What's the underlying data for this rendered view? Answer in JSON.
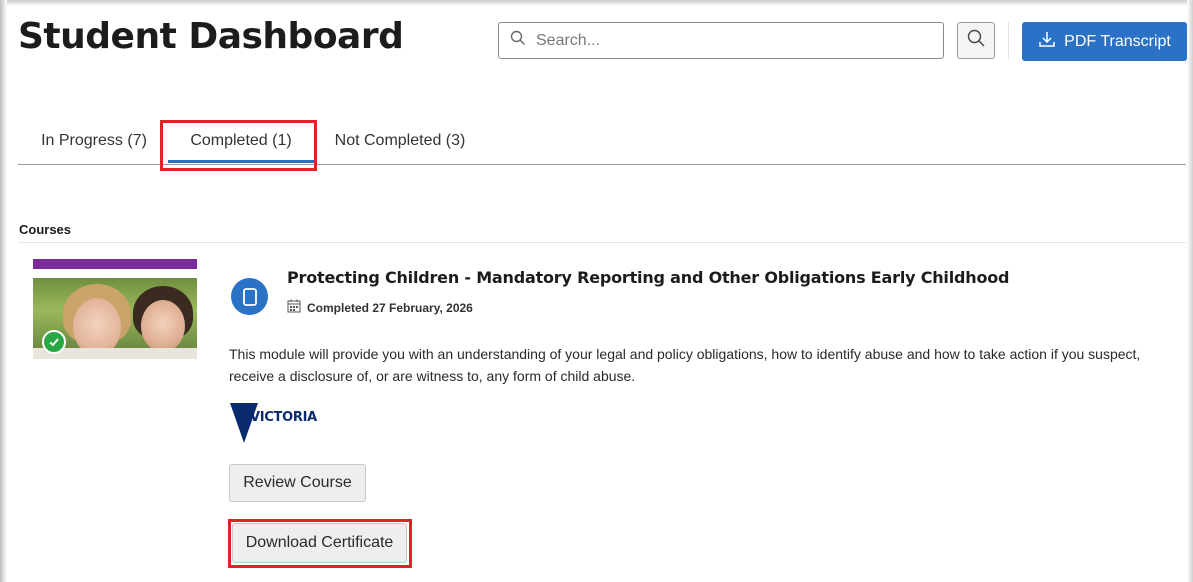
{
  "header": {
    "title": "Student Dashboard",
    "search_placeholder": "Search...",
    "pdf_button_label": "PDF Transcript"
  },
  "tabs": [
    {
      "label": "In Progress (7)",
      "active": false
    },
    {
      "label": "Completed (1)",
      "active": true
    },
    {
      "label": "Not Completed (3)",
      "active": false
    }
  ],
  "section": {
    "label": "Courses"
  },
  "course": {
    "title": "Protecting Children - Mandatory Reporting and Other Obligations Early Childhood",
    "completed_text": "Completed 27 February, 2026",
    "description": "This module will provide you with an understanding of your legal and policy obligations, how to identify abuse and how to take action if you suspect, receive a disclosure of, or are witness to, any form of child abuse.",
    "provider_logo_text": "VICTORIA",
    "review_button_label": "Review Course",
    "download_button_label": "Download Certificate"
  },
  "colors": {
    "accent_blue": "#2b72c7",
    "highlight_red": "#e32228",
    "category_purple": "#7b2a9c",
    "complete_green": "#2aa745"
  }
}
